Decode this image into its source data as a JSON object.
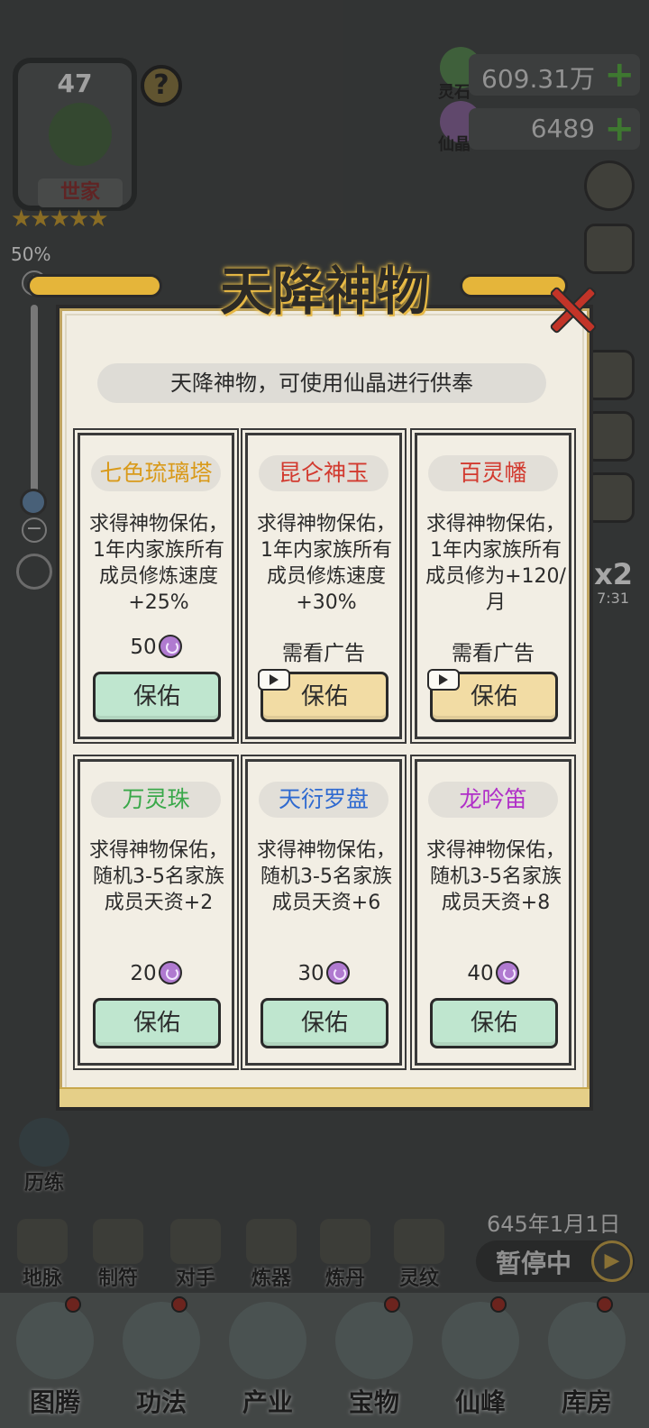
{
  "hud": {
    "clan_level": "47",
    "clan_title": "世家",
    "stars": "★★★★★",
    "help": "?",
    "zoom_percent": "50%",
    "zoom_plus": "+",
    "zoom_minus": "−",
    "lingshi_label": "灵石",
    "lingshi_value": "609.31万",
    "xianjing_label": "仙晶",
    "xianjing_value": "6489",
    "add": "+",
    "speed": "x2",
    "speed_time": "7:31",
    "zoom_level": 0.5
  },
  "modal": {
    "title": "天降神物",
    "subtitle": "天降神物，可使用仙晶进行供奉",
    "cards": [
      {
        "name": "七色琉璃塔",
        "name_color": "#d99a1a",
        "desc": "求得神物保佑，1年内家族所有成员修炼速度+25%",
        "cost": "50",
        "button": "保佑",
        "style": "green"
      },
      {
        "name": "昆仑神玉",
        "name_color": "#d23a2f",
        "desc": "求得神物保佑，1年内家族所有成员修炼速度+30%",
        "cost": "需看广告",
        "button": "保佑",
        "style": "gold"
      },
      {
        "name": "百灵幡",
        "name_color": "#d23a2f",
        "desc": "求得神物保佑，1年内家族所有成员修为+120/月",
        "cost": "需看广告",
        "button": "保佑",
        "style": "gold"
      },
      {
        "name": "万灵珠",
        "name_color": "#3aa84a",
        "desc": "求得神物保佑，随机3-5名家族成员天资+2",
        "cost": "20",
        "button": "保佑",
        "style": "green"
      },
      {
        "name": "天衍罗盘",
        "name_color": "#2f6ad0",
        "desc": "求得神物保佑，随机3-5名家族成员天资+6",
        "cost": "30",
        "button": "保佑",
        "style": "green"
      },
      {
        "name": "龙吟笛",
        "name_color": "#b02fc8",
        "desc": "求得神物保佑，随机3-5名家族成员天资+8",
        "cost": "40",
        "button": "保佑",
        "style": "green"
      }
    ]
  },
  "tools": {
    "liandeng": "历练",
    "items": [
      "地脉",
      "制符",
      "对手",
      "炼器",
      "炼丹",
      "灵纹"
    ]
  },
  "game_date": "645年1月1日",
  "pause_label": "暂停中",
  "bottom_nav": [
    "图腾",
    "功法",
    "产业",
    "宝物",
    "仙峰",
    "库房"
  ]
}
